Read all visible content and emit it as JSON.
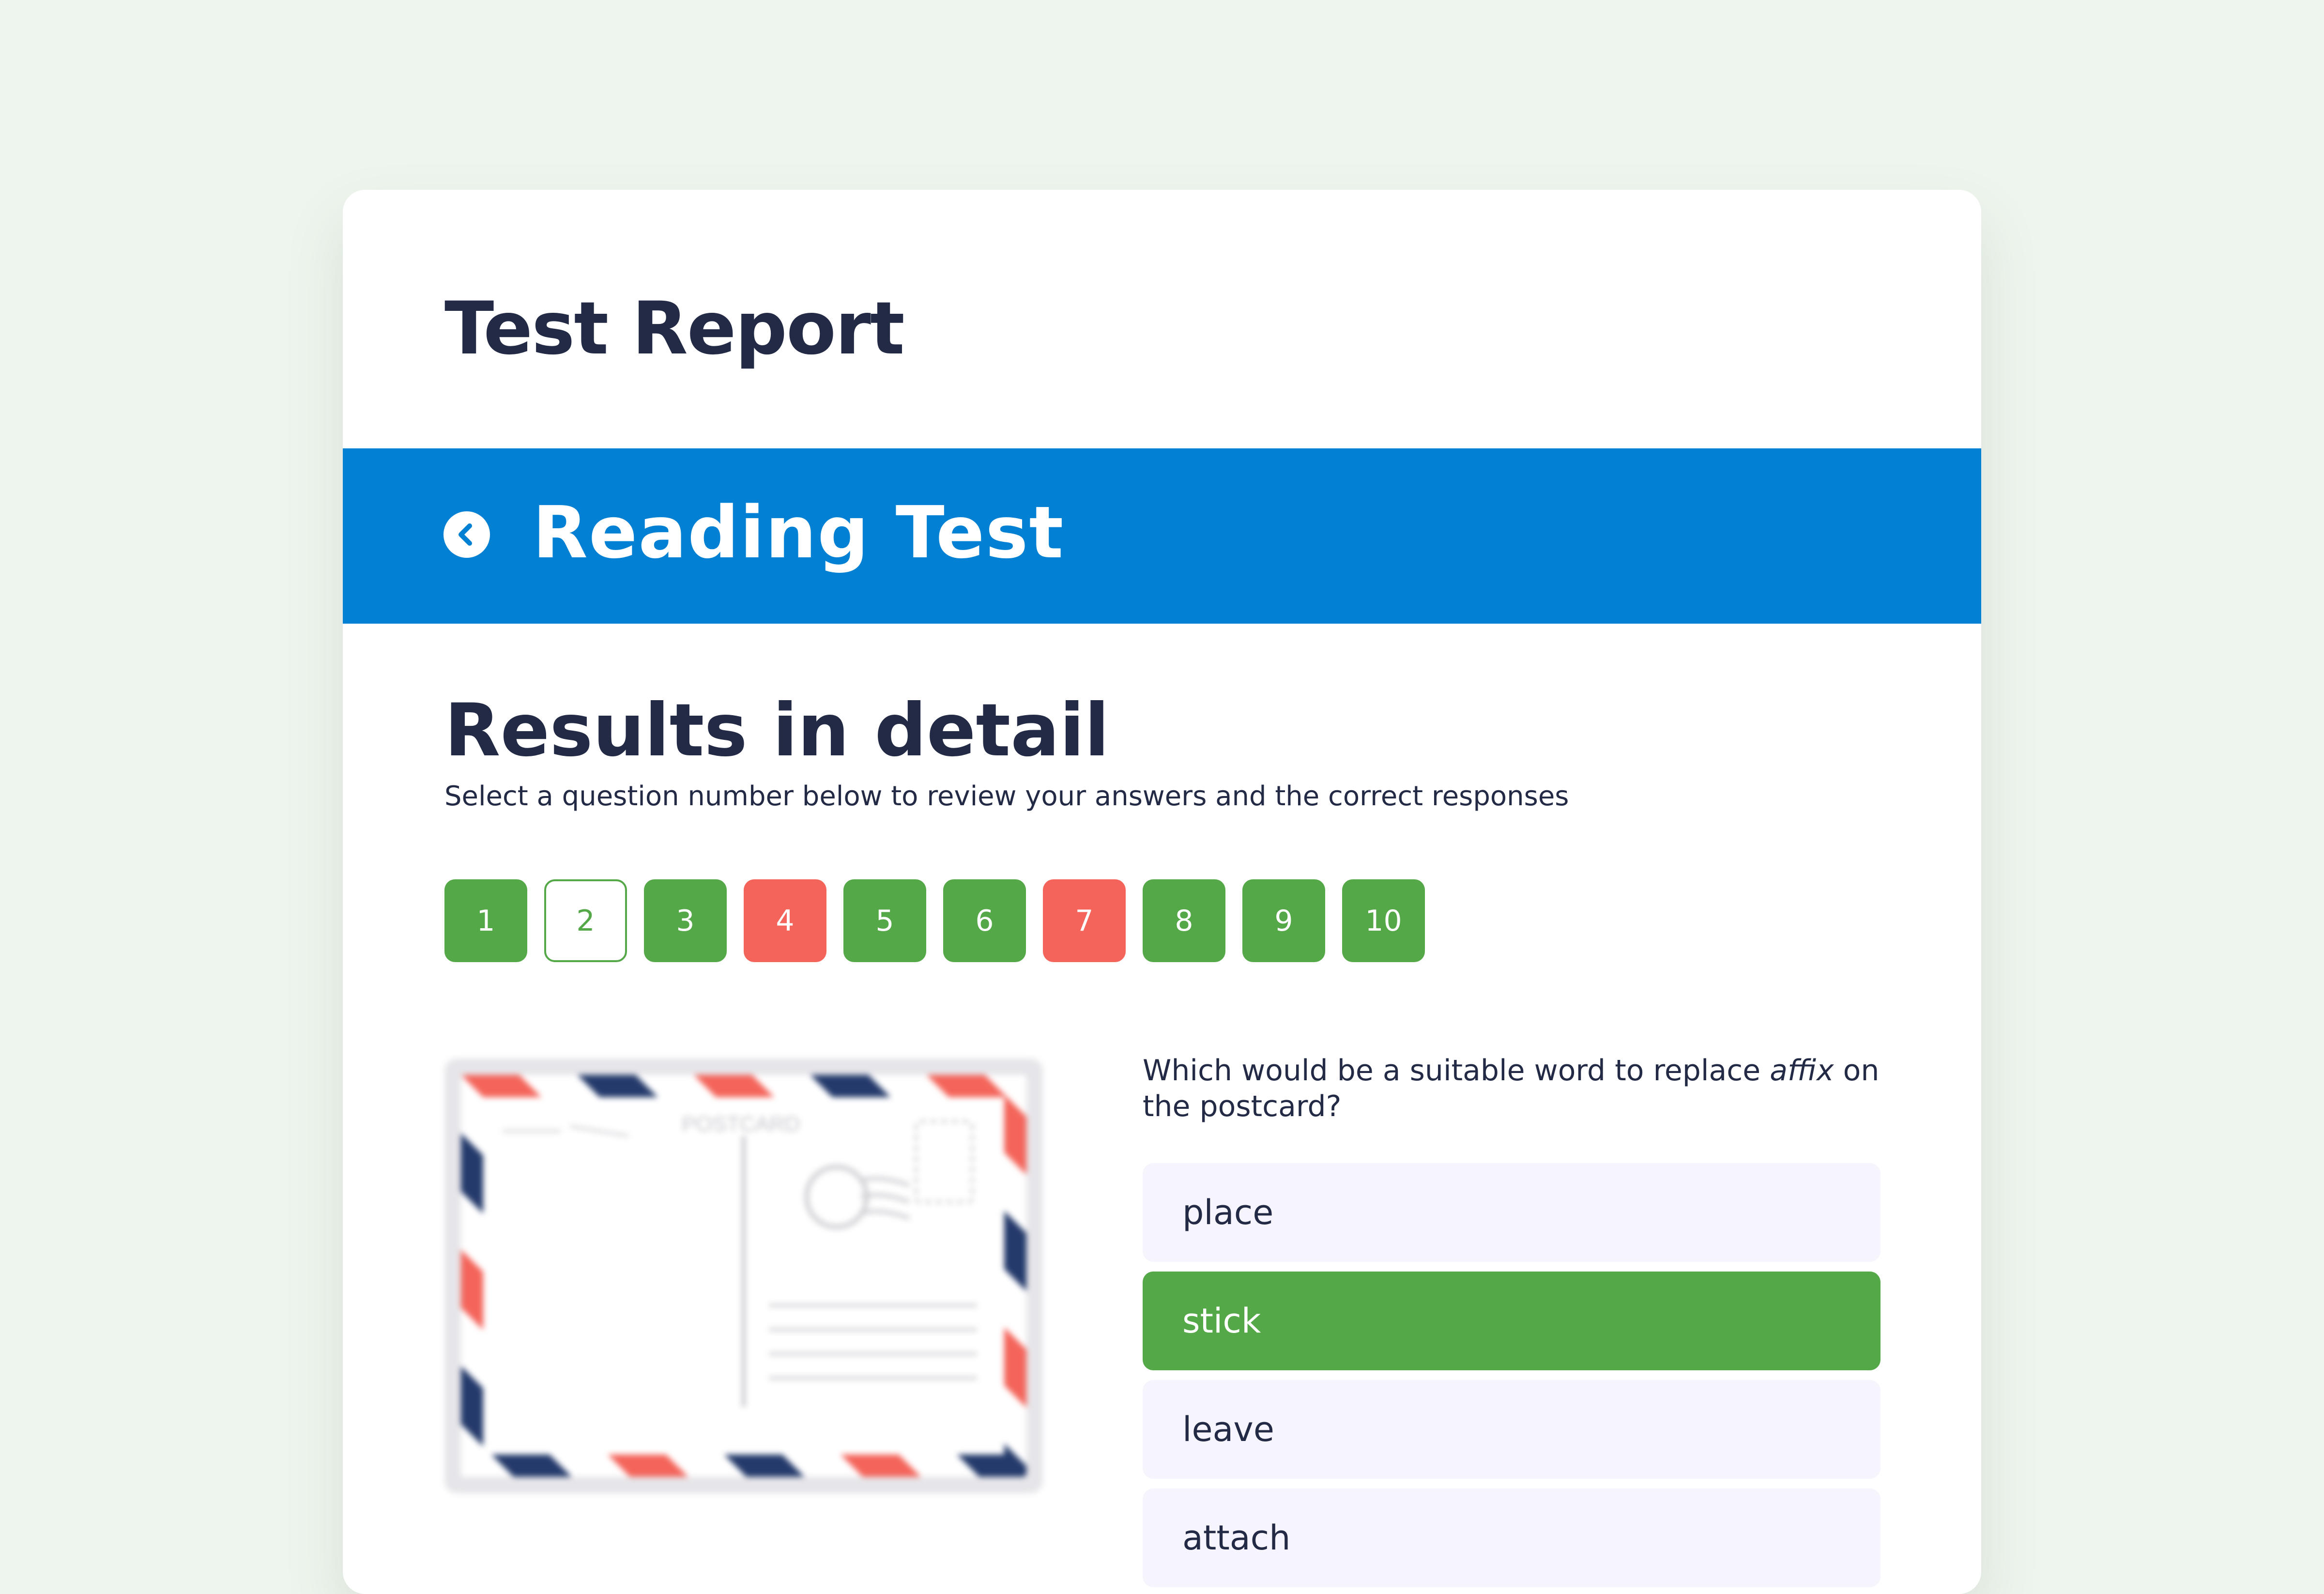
{
  "report": {
    "title": "Test Report"
  },
  "banner": {
    "title": "Reading Test",
    "icon": "chevron-left-icon",
    "color": "#0280d4"
  },
  "results": {
    "title": "Results in detail",
    "subtitle": "Select a question number below to review your answers and the correct responses"
  },
  "questions": [
    {
      "label": "1",
      "status": "correct"
    },
    {
      "label": "2",
      "status": "selected"
    },
    {
      "label": "3",
      "status": "correct"
    },
    {
      "label": "4",
      "status": "wrong"
    },
    {
      "label": "5",
      "status": "correct"
    },
    {
      "label": "6",
      "status": "correct"
    },
    {
      "label": "7",
      "status": "wrong"
    },
    {
      "label": "8",
      "status": "correct"
    },
    {
      "label": "9",
      "status": "correct"
    },
    {
      "label": "10",
      "status": "correct"
    }
  ],
  "status_colors": {
    "correct": "#55a848",
    "wrong": "#f4645a"
  },
  "question": {
    "text_before": "Which would be a suitable word to replace ",
    "word": "affix",
    "text_after": " on the postcard?",
    "image_text": "POSTCARD"
  },
  "options": [
    {
      "label": "place",
      "chosen": false
    },
    {
      "label": "stick",
      "chosen": true
    },
    {
      "label": "leave",
      "chosen": false
    },
    {
      "label": "attach",
      "chosen": false
    }
  ]
}
